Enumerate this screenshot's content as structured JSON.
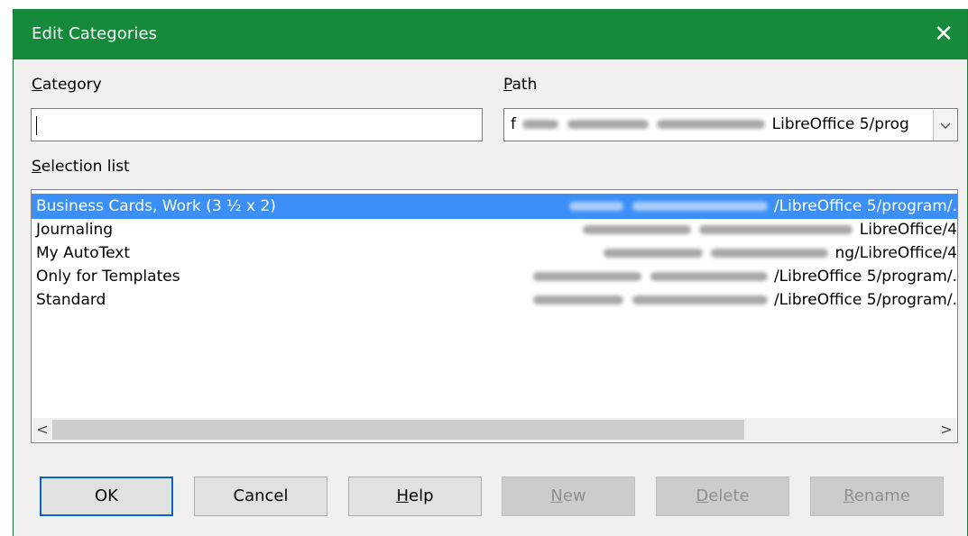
{
  "window": {
    "title": "Edit Categories",
    "close_glyph": "✕"
  },
  "category": {
    "label_mnemonic": "C",
    "label_rest": "ategory",
    "value": ""
  },
  "path": {
    "label_mnemonic": "P",
    "label_rest": "ath",
    "value_start": "f",
    "value_visible": "LibreOffice 5/prog",
    "dropdown_icon": "chevron-down-icon"
  },
  "selection_list": {
    "label_mnemonic": "S",
    "label_rest": "election list",
    "items": [
      {
        "name": "Business Cards, Work (3 ½ x 2)",
        "path_visible": "/LibreOffice 5/program/.",
        "selected": true
      },
      {
        "name": "Journaling",
        "path_visible": "LibreOffice/4",
        "selected": false
      },
      {
        "name": "My AutoText",
        "path_visible": "ng/LibreOffice/4",
        "selected": false
      },
      {
        "name": "Only for Templates",
        "path_visible": "/LibreOffice 5/program/.",
        "selected": false
      },
      {
        "name": "Standard",
        "path_visible": "/LibreOffice 5/program/.",
        "selected": false
      }
    ],
    "scroll_left_glyph": "<",
    "scroll_right_glyph": ">"
  },
  "buttons": {
    "ok": "OK",
    "cancel": "Cancel",
    "help_mnemonic": "H",
    "help_rest": "elp",
    "new_mnemonic": "N",
    "new_rest": "ew",
    "delete_mnemonic": "D",
    "delete_rest": "elete",
    "rename_mnemonic": "R",
    "rename_rest": "ename"
  },
  "colors": {
    "titlebar": "#148a3a",
    "selection": "#3c8ff7",
    "default_button_border": "#0a64c8"
  }
}
